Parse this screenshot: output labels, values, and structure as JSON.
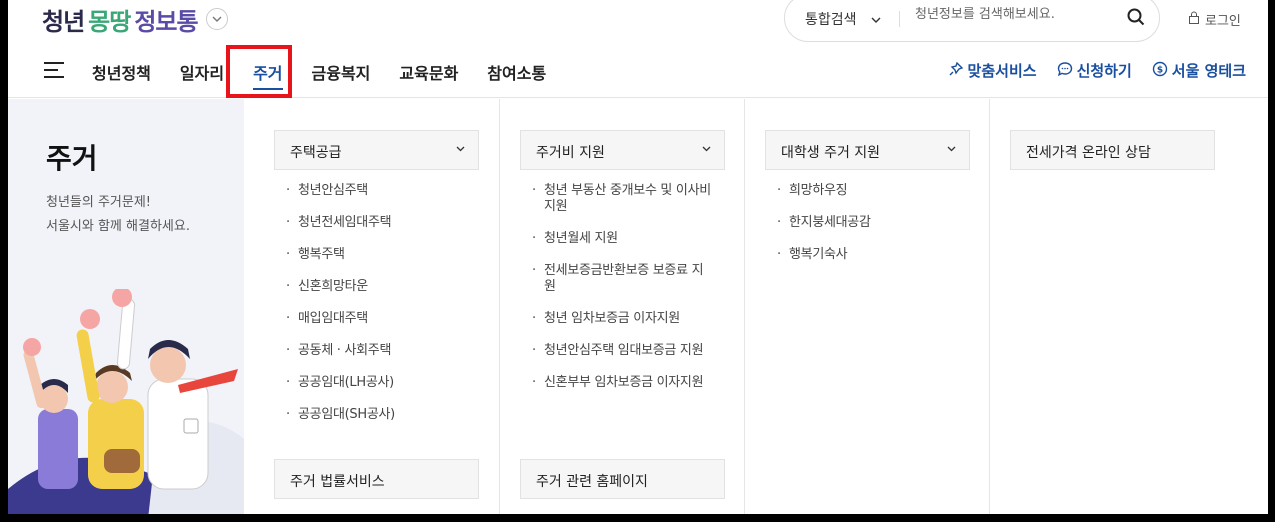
{
  "header": {
    "logo": {
      "part1": "청년",
      "part2": "몽땅",
      "part3": "정보통"
    },
    "search": {
      "scope": "통합검색",
      "placeholder": "청년정보를 검색해보세요."
    },
    "login_label": "로그인"
  },
  "nav": {
    "items": [
      {
        "label": "청년정책"
      },
      {
        "label": "일자리"
      },
      {
        "label": "주거"
      },
      {
        "label": "금융복지"
      },
      {
        "label": "교육문화"
      },
      {
        "label": "참여소통"
      }
    ],
    "right_links": [
      {
        "label": "맞춤서비스",
        "icon": "pin-icon"
      },
      {
        "label": "신청하기",
        "icon": "chat-icon"
      },
      {
        "label": "서울 영테크",
        "icon": "coin-icon"
      }
    ],
    "highlight_color": "#e8141c",
    "accent_color": "#1a4fa0"
  },
  "mega": {
    "title": "주거",
    "desc_line1": "청년들의 주거문제!",
    "desc_line2": "서울시와 함께 해결하세요.",
    "columns": [
      {
        "header": "주택공급",
        "items": [
          "청년안심주택",
          "청년전세임대주택",
          "행복주택",
          "신혼희망타운",
          "매입임대주택",
          "공동체 · 사회주택",
          "공공임대(LH공사)",
          "공공임대(SH공사)"
        ],
        "bottom": "주거 법률서비스"
      },
      {
        "header": "주거비 지원",
        "items": [
          "청년 부동산 중개보수 및 이사비 지원",
          "청년월세 지원",
          "전세보증금반환보증 보증료 지원",
          "청년 임차보증금 이자지원",
          "청년안심주택 임대보증금 지원",
          "신혼부부 임차보증금 이자지원"
        ],
        "bottom": "주거 관련 홈페이지"
      },
      {
        "header": "대학생 주거 지원",
        "items": [
          "희망하우징",
          "한지붕세대공감",
          "행복기숙사"
        ]
      },
      {
        "header": "전세가격 온라인 상담",
        "items": []
      }
    ]
  }
}
